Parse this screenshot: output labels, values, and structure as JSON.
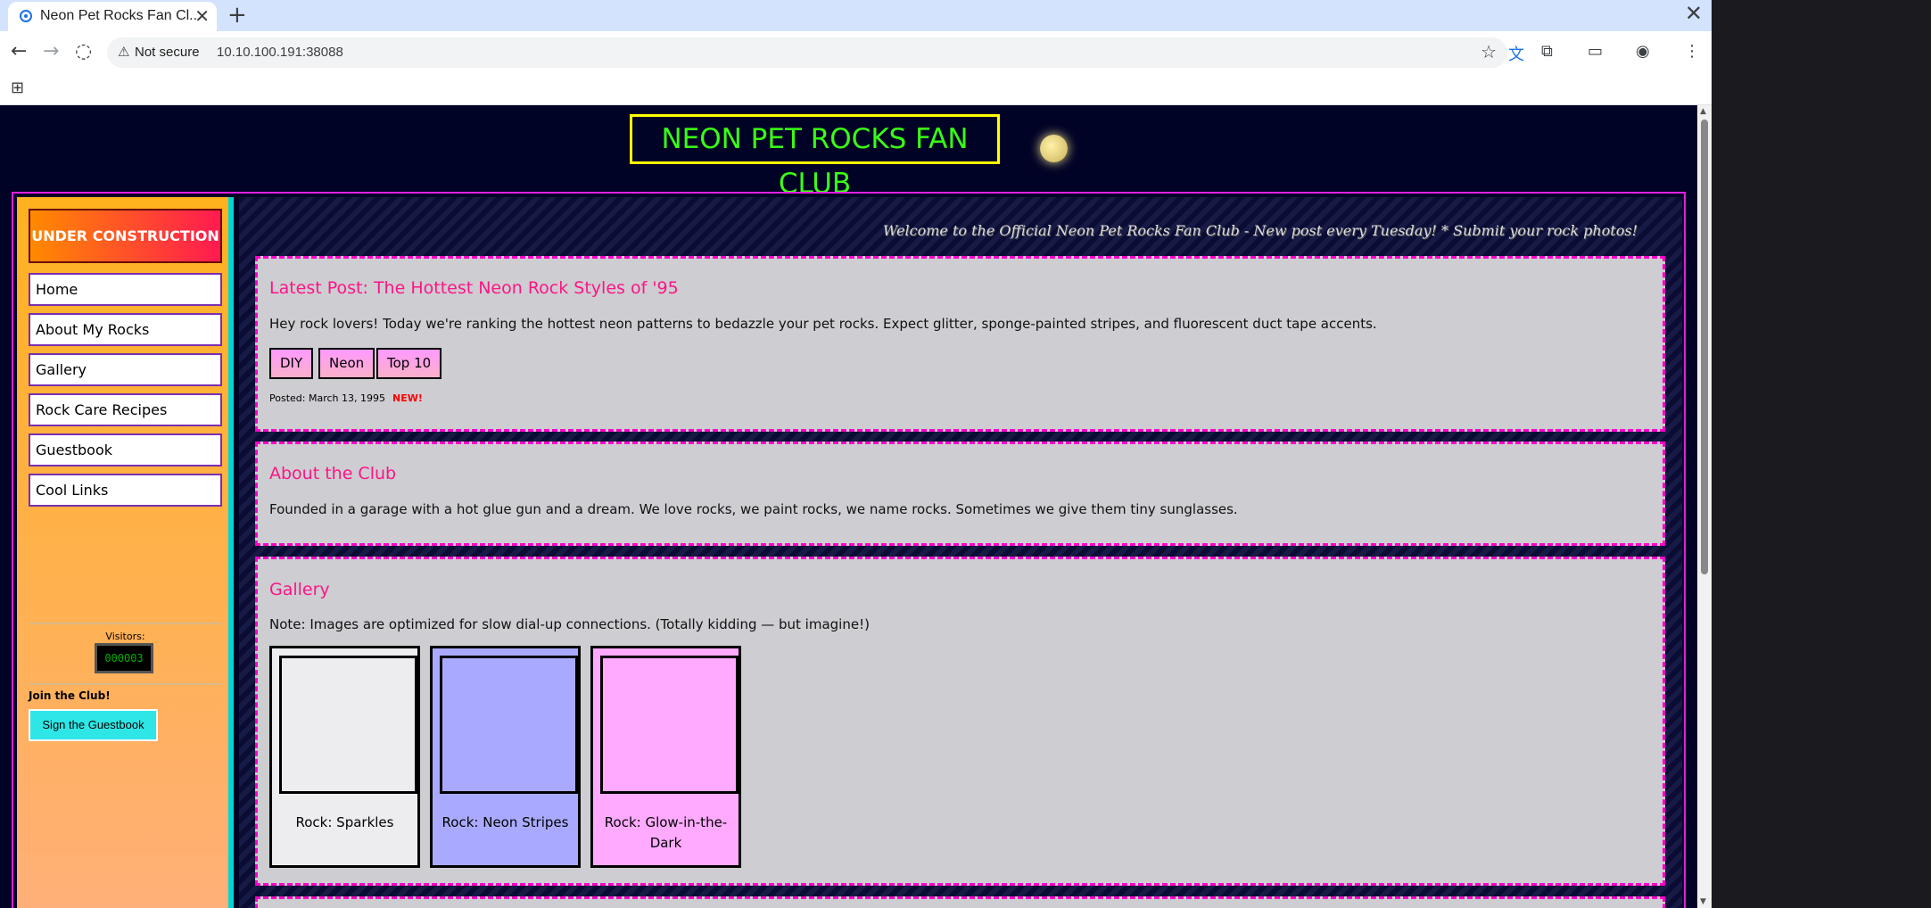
{
  "browser": {
    "tab_title": "Neon Pet Rocks Fan Cl...",
    "new_tab": "+",
    "tab_close": "✕",
    "window_close": "✕",
    "security_label": "Not secure",
    "url": "10.10.100.191:38088"
  },
  "site": {
    "title": "NEON PET ROCKS FAN CLUB"
  },
  "sidebar": {
    "construction": "UNDER CONSTRUCTION",
    "nav": [
      "Home",
      "About My Rocks",
      "Gallery",
      "Rock Care Recipes",
      "Guestbook",
      "Cool Links"
    ],
    "visitors_label": "Visitors:",
    "visitors_count": "000003",
    "join_label": "Join the Club!",
    "guestbook_button": "Sign the Guestbook"
  },
  "marquee": "Welcome to the Official Neon Pet Rocks Fan Club - New post every Tuesday!   *   Submit your rock photos!",
  "latest_post": {
    "title": "Latest Post: The Hottest Neon Rock Styles of '95",
    "body": "Hey rock lovers! Today we're ranking the hottest neon patterns to bedazzle your pet rocks. Expect glitter, sponge-painted stripes, and fluorescent duct tape accents.",
    "tags": [
      "DIY",
      "Neon",
      "Top 10"
    ],
    "posted": "Posted: March 13, 1995",
    "new_badge": "NEW!"
  },
  "about": {
    "title": "About the Club",
    "body": "Founded in a garage with a hot glue gun and a dream. We love rocks, we paint rocks, we name rocks. Sometimes we give them tiny sunglasses."
  },
  "gallery": {
    "title": "Gallery",
    "note": "Note: Images are optimized for slow dial-up connections. (Totally kidding — but imagine!)",
    "items": [
      {
        "caption": "Rock: Sparkles",
        "color": "#ededf0"
      },
      {
        "caption": "Rock: Neon Stripes",
        "color": "#a9aaff"
      },
      {
        "caption": "Rock: Glow-in-the-Dark",
        "color": "#ffaaff"
      }
    ]
  },
  "colors": {
    "title_text": "#39ff14",
    "title_border": "#ffff00",
    "heading_pink": "#ff1486",
    "card_border": "#ff00c8",
    "page_bg": "#000226"
  }
}
